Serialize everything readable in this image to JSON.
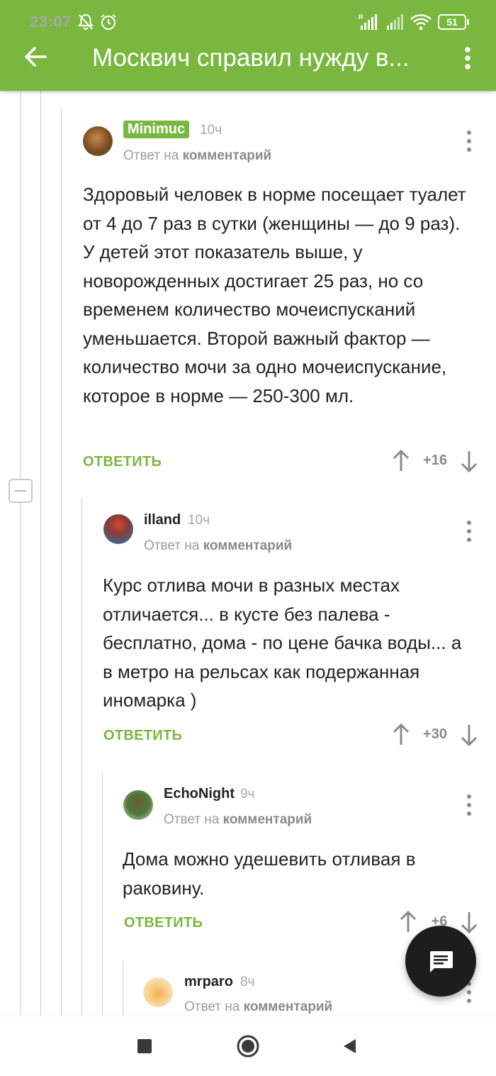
{
  "status_bar": {
    "time": "23:07",
    "battery": "51"
  },
  "app_bar": {
    "title": "Москвич справил нужду в..."
  },
  "comments": [
    {
      "author": "Minimuc",
      "time": "10ч",
      "reply_prefix": "Ответ на",
      "reply_link": "комментарий",
      "body": "Здоровый человек в норме посещает туалет от 4 до 7 раз в сутки (женщины — до 9 раз). У детей этот показатель выше, у новорожденных достигает 25 раз, но со временем количество мочеиспусканий уменьшается. Второй важный фактор — количество мочи за одно мочеиспускание, которое в норме — 250-300 мл.",
      "reply_label": "ОТВЕТИТЬ",
      "score": "+16"
    },
    {
      "author": "illand",
      "time": "10ч",
      "reply_prefix": "Ответ на",
      "reply_link": "комментарий",
      "body": "Курс отлива мочи в разных местах отличается... в кусте без палева - бесплатно, дома - по цене бачка воды... а в метро на рельсах как подержанная иномарка )",
      "reply_label": "ОТВЕТИТЬ",
      "score": "+30"
    },
    {
      "author": "EchoNight",
      "time": "9ч",
      "reply_prefix": "Ответ на",
      "reply_link": "комментарий",
      "body": "Дома можно удешевить отливая в раковину.",
      "reply_label": "ОТВЕТИТЬ",
      "score": "+6"
    },
    {
      "author": "mrparo",
      "time": "8ч",
      "reply_prefix": "Ответ на",
      "reply_link": "комментарий"
    }
  ],
  "colors": {
    "accent": "#79b73f",
    "fab": "#1d1d1d"
  },
  "icons": {
    "back": "arrow-left-icon",
    "more": "more-vert-icon",
    "fab": "comment-icon",
    "upvote": "arrow-up-icon",
    "downvote": "arrow-down-icon",
    "collapse": "minus-icon"
  }
}
